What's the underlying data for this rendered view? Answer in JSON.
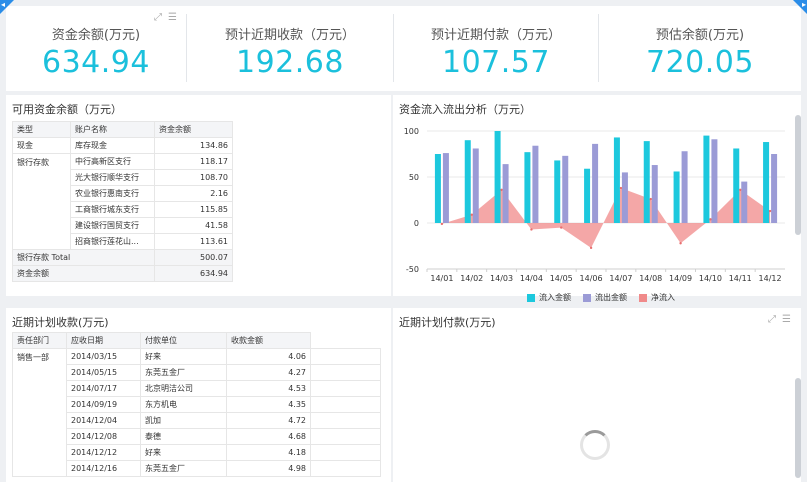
{
  "kpis": [
    {
      "label": "资金余额(万元)",
      "value": "634.94"
    },
    {
      "label": "预计近期收款（万元）",
      "value": "192.68"
    },
    {
      "label": "预计近期付款（万元）",
      "value": "107.57"
    },
    {
      "label": "预估余额(万元)",
      "value": "720.05"
    }
  ],
  "balance": {
    "title": "可用资金余额（万元）",
    "headers": [
      "类型",
      "账户名称",
      "资金余额"
    ],
    "cash": {
      "type": "现金",
      "account": "库存现金",
      "amount": "134.86"
    },
    "bank_group": "银行存款",
    "bank_rows": [
      {
        "account": "中行高新区支行",
        "amount": "118.17"
      },
      {
        "account": "光大银行顺华支行",
        "amount": "108.70"
      },
      {
        "account": "农业银行惠南支行",
        "amount": "2.16"
      },
      {
        "account": "工商银行城东支行",
        "amount": "115.85"
      },
      {
        "account": "建设银行国贸支行",
        "amount": "41.58"
      },
      {
        "account": "招商银行莲花山...",
        "amount": "113.61"
      }
    ],
    "bank_total_label": "银行存款 Total",
    "bank_total": "500.07",
    "grand_total_label": "资金余额",
    "grand_total": "634.94"
  },
  "flow": {
    "title": "资金流入流出分析（万元）",
    "legend": [
      "流入金额",
      "流出金额",
      "净流入"
    ]
  },
  "chart_data": {
    "type": "bar",
    "title": "资金流入流出分析（万元）",
    "categories": [
      "14/01",
      "14/02",
      "14/03",
      "14/04",
      "14/05",
      "14/06",
      "14/07",
      "14/08",
      "14/09",
      "14/10",
      "14/11",
      "14/12"
    ],
    "series": [
      {
        "name": "流入金额",
        "type": "bar",
        "color": "#1cc8dd",
        "values": [
          75,
          90,
          100,
          77,
          68,
          59,
          93,
          89,
          56,
          95,
          81,
          88
        ]
      },
      {
        "name": "流出金额",
        "type": "bar",
        "color": "#9b9bd6",
        "values": [
          76,
          81,
          64,
          84,
          73,
          86,
          55,
          63,
          78,
          91,
          45,
          75
        ]
      },
      {
        "name": "净流入",
        "type": "area",
        "color": "#f08a8a",
        "values": [
          -1,
          9,
          36,
          -7,
          -5,
          -27,
          38,
          26,
          -22,
          4,
          36,
          13
        ]
      }
    ],
    "ylim": [
      -50,
      100
    ],
    "yticks": [
      -50,
      0,
      50,
      100
    ],
    "legend_position": "bottom"
  },
  "receipts": {
    "title": "近期计划收款(万元)",
    "headers": [
      "责任部门",
      "应收日期",
      "付款单位",
      "收款金额"
    ],
    "group": "销售一部",
    "rows": [
      {
        "date": "2014/03/15",
        "payer": "好来",
        "amount": "4.06"
      },
      {
        "date": "2014/05/15",
        "payer": "东莞五金厂",
        "amount": "4.27"
      },
      {
        "date": "2014/07/17",
        "payer": "北京明洁公司",
        "amount": "4.53"
      },
      {
        "date": "2014/09/19",
        "payer": "东方机电",
        "amount": "4.35"
      },
      {
        "date": "2014/12/04",
        "payer": "凯加",
        "amount": "4.72"
      },
      {
        "date": "2014/12/08",
        "payer": "泰德",
        "amount": "4.68"
      },
      {
        "date": "2014/12/12",
        "payer": "好来",
        "amount": "4.18"
      },
      {
        "date": "2014/12/16",
        "payer": "东莞五金厂",
        "amount": "4.98"
      }
    ]
  },
  "payments": {
    "title": "近期计划付款(万元)"
  },
  "icons": {
    "expand": "expand-icon",
    "menu": "menu-icon"
  }
}
